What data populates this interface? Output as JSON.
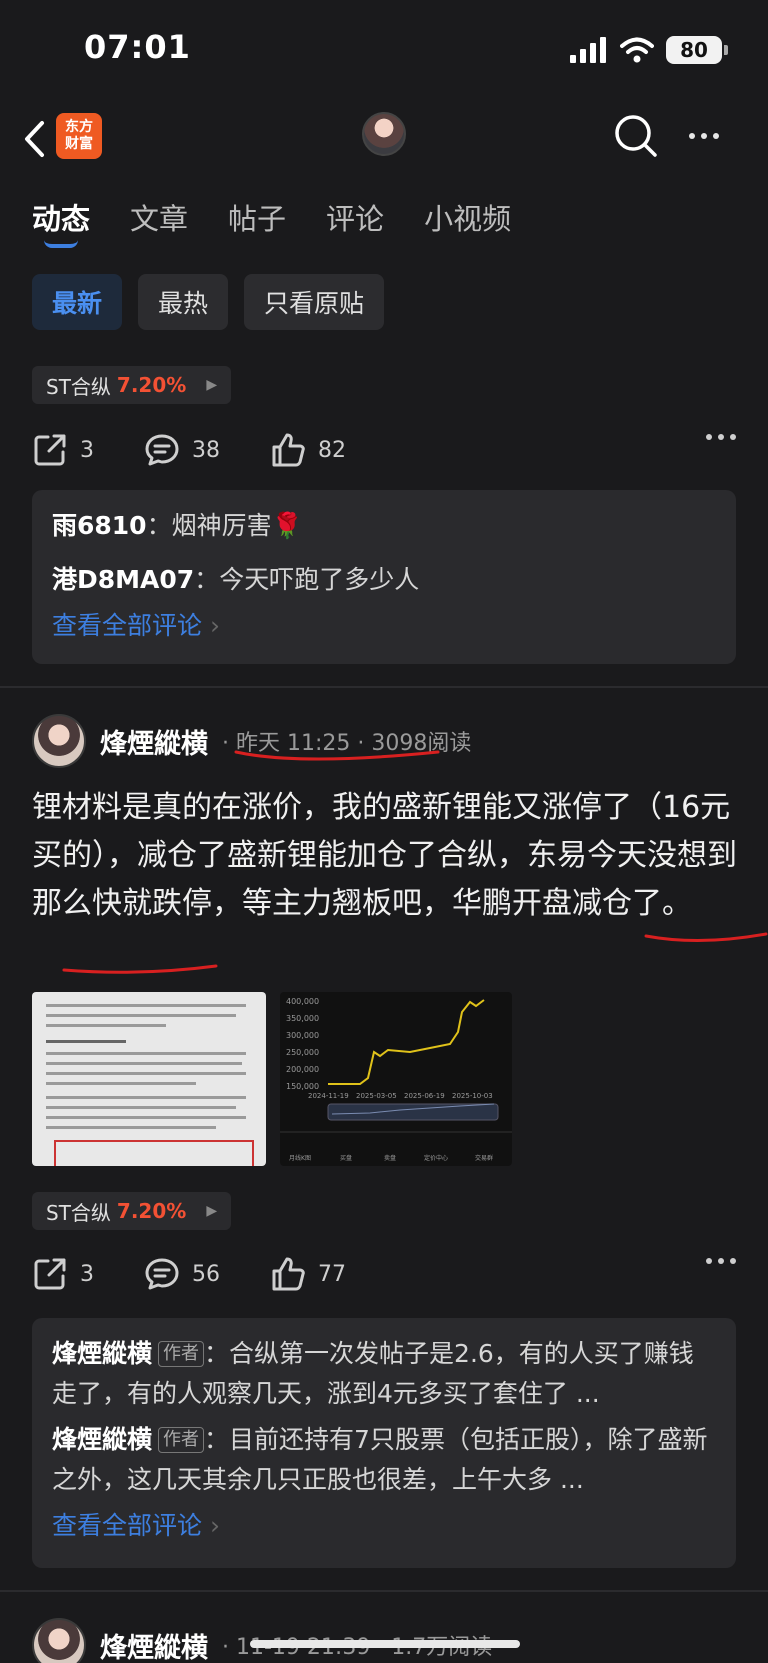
{
  "status": {
    "time": "07:01",
    "battery": "80"
  },
  "nav": {
    "logo_line1": "东方",
    "logo_line2": "财富"
  },
  "tabs": [
    {
      "label": "动态"
    },
    {
      "label": "文章"
    },
    {
      "label": "帖子"
    },
    {
      "label": "评论"
    },
    {
      "label": "小视频"
    }
  ],
  "filters": [
    {
      "label": "最新"
    },
    {
      "label": "最热"
    },
    {
      "label": "只看原贴"
    }
  ],
  "post1": {
    "stock": {
      "name": "ST合纵",
      "change": "7.20%"
    },
    "share_count": "3",
    "comment_count": "38",
    "like_count": "82",
    "comments": [
      {
        "user": "雨6810",
        "text": "烟神厉害🌹"
      },
      {
        "user": "港D8MA07",
        "text": "今天吓跑了多少人"
      }
    ],
    "view_all": "查看全部评论"
  },
  "post2": {
    "author": "烽煙縱横",
    "time": "昨天 11:25",
    "reads": "3098阅读",
    "body": "锂材料是真的在涨价，我的盛新锂能又涨停了（16元买的），减仓了盛新锂能加仓了合纵，东易今天没想到那么快就跌停，等主力翘板吧，华鹏开盘减仓了。",
    "chart_axis": {
      "y_ticks": [
        "400,000",
        "350,000",
        "300,000",
        "250,000",
        "200,000",
        "150,000"
      ],
      "x_ticks": [
        "2024-11-19",
        "2025-03-05",
        "2025-06-19",
        "2025-10-03"
      ],
      "bottom_tabs": [
        "月线K图",
        "买盘",
        "卖盘",
        "定价中心",
        "交易群"
      ]
    },
    "stock": {
      "name": "ST合纵",
      "change": "7.20%"
    },
    "share_count": "3",
    "comment_count": "56",
    "like_count": "77",
    "comments": [
      {
        "user": "烽煙縱横",
        "tag": "作者",
        "text": "合纵第一次发帖子是2.6，有的人买了赚钱走了，有的人观察几天，涨到4元多买了套住了 ..."
      },
      {
        "user": "烽煙縱横",
        "tag": "作者",
        "text": "目前还持有7只股票（包括正股），除了盛新之外，这几天其余几只正股也很差，上午大多 ..."
      }
    ],
    "view_all": "查看全部评论"
  },
  "post3": {
    "author": "烽煙縱横",
    "meta": "11-19 21:39 · 1.7万阅读"
  }
}
